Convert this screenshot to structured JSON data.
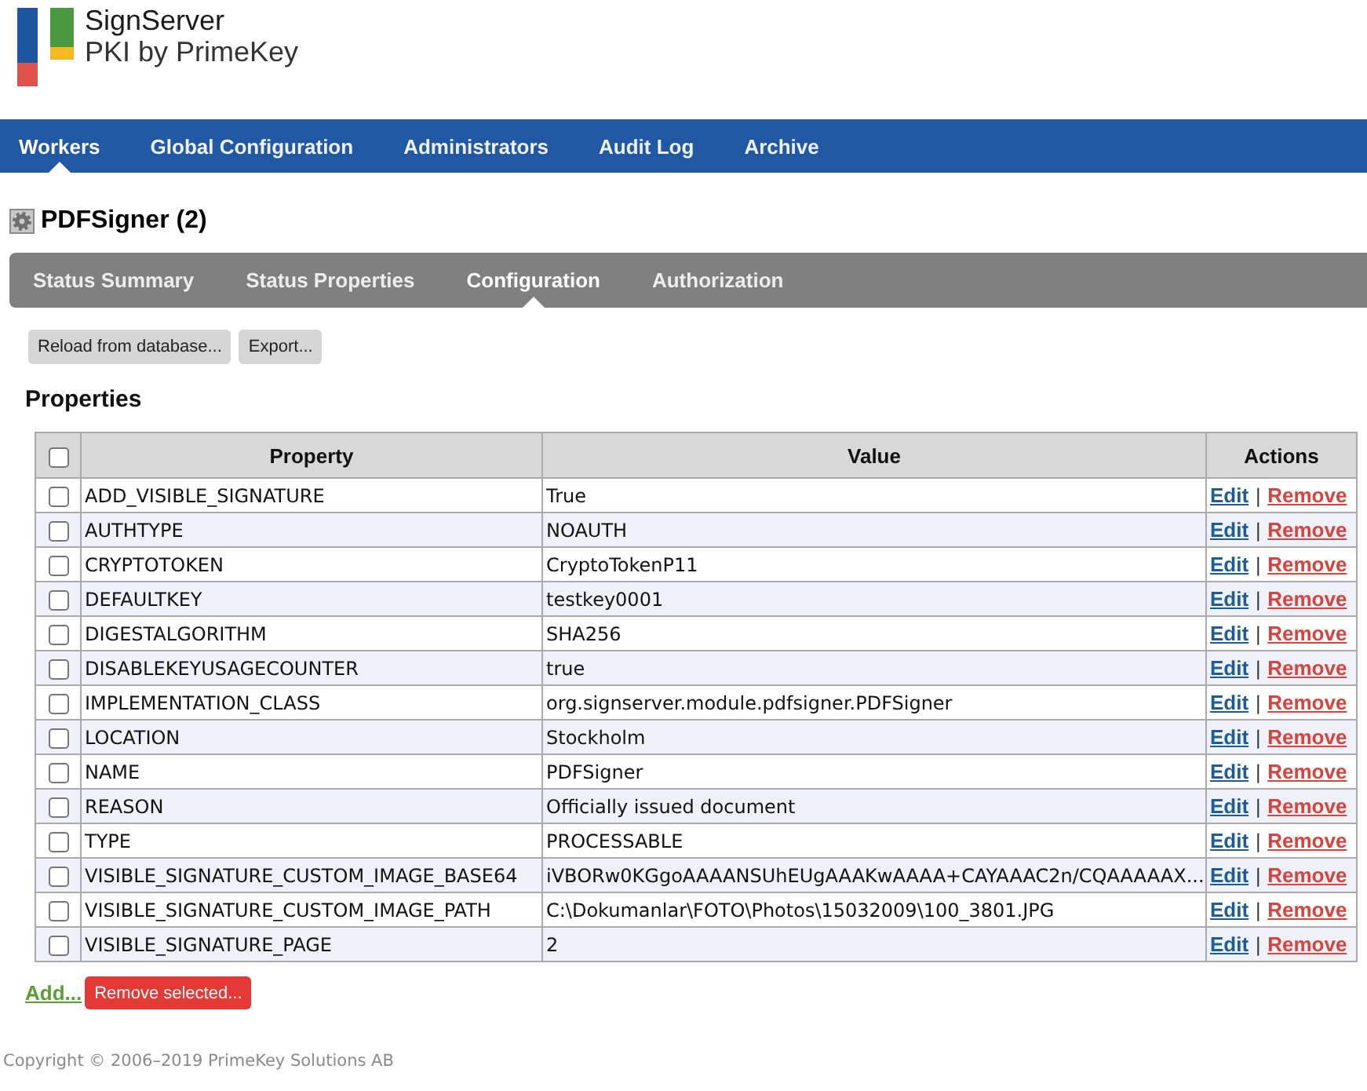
{
  "brand": {
    "name": "SignServer",
    "tagline": "PKI by PrimeKey"
  },
  "nav": [
    {
      "label": "Workers",
      "selected": true
    },
    {
      "label": "Global Configuration",
      "selected": false
    },
    {
      "label": "Administrators",
      "selected": false
    },
    {
      "label": "Audit Log",
      "selected": false
    },
    {
      "label": "Archive",
      "selected": false
    }
  ],
  "page_title": "PDFSigner (2)",
  "tabs": [
    {
      "label": "Status Summary",
      "selected": false
    },
    {
      "label": "Status Properties",
      "selected": false
    },
    {
      "label": "Configuration",
      "selected": true
    },
    {
      "label": "Authorization",
      "selected": false
    }
  ],
  "toolbar_buttons": [
    "Reload from database...",
    "Export..."
  ],
  "section_title": "Properties",
  "table": {
    "select_all": {
      "checked": false
    },
    "columns": [
      "Property",
      "Value",
      "Actions"
    ],
    "rows": [
      {
        "checked": false,
        "property": "ADD_VISIBLE_SIGNATURE",
        "value": "True",
        "actions": [
          {
            "kind": "edit",
            "label": "Edit"
          },
          {
            "kind": "separator",
            "label": "|"
          },
          {
            "kind": "remove",
            "label": "Remove"
          }
        ]
      },
      {
        "checked": false,
        "property": "AUTHTYPE",
        "value": "NOAUTH",
        "actions": [
          {
            "kind": "edit",
            "label": "Edit"
          },
          {
            "kind": "separator",
            "label": "|"
          },
          {
            "kind": "remove",
            "label": "Remove"
          }
        ]
      },
      {
        "checked": false,
        "property": "CRYPTOTOKEN",
        "value": "CryptoTokenP11",
        "actions": [
          {
            "kind": "edit",
            "label": "Edit"
          },
          {
            "kind": "separator",
            "label": "|"
          },
          {
            "kind": "remove",
            "label": "Remove"
          }
        ]
      },
      {
        "checked": false,
        "property": "DEFAULTKEY",
        "value": "testkey0001",
        "actions": [
          {
            "kind": "edit",
            "label": "Edit"
          },
          {
            "kind": "separator",
            "label": "|"
          },
          {
            "kind": "remove",
            "label": "Remove"
          }
        ]
      },
      {
        "checked": false,
        "property": "DIGESTALGORITHM",
        "value": "SHA256",
        "actions": [
          {
            "kind": "edit",
            "label": "Edit"
          },
          {
            "kind": "separator",
            "label": "|"
          },
          {
            "kind": "remove",
            "label": "Remove"
          }
        ]
      },
      {
        "checked": false,
        "property": "DISABLEKEYUSAGECOUNTER",
        "value": "true",
        "actions": [
          {
            "kind": "edit",
            "label": "Edit"
          },
          {
            "kind": "separator",
            "label": "|"
          },
          {
            "kind": "remove",
            "label": "Remove"
          }
        ]
      },
      {
        "checked": false,
        "property": "IMPLEMENTATION_CLASS",
        "value": "org.signserver.module.pdfsigner.PDFSigner",
        "actions": [
          {
            "kind": "edit",
            "label": "Edit"
          },
          {
            "kind": "separator",
            "label": "|"
          },
          {
            "kind": "remove",
            "label": "Remove"
          }
        ]
      },
      {
        "checked": false,
        "property": "LOCATION",
        "value": "Stockholm",
        "actions": [
          {
            "kind": "edit",
            "label": "Edit"
          },
          {
            "kind": "separator",
            "label": "|"
          },
          {
            "kind": "remove",
            "label": "Remove"
          }
        ]
      },
      {
        "checked": false,
        "property": "NAME",
        "value": "PDFSigner",
        "actions": [
          {
            "kind": "edit",
            "label": "Edit"
          },
          {
            "kind": "separator",
            "label": "|"
          },
          {
            "kind": "remove",
            "label": "Remove"
          }
        ]
      },
      {
        "checked": false,
        "property": "REASON",
        "value": "Officially issued document",
        "actions": [
          {
            "kind": "edit",
            "label": "Edit"
          },
          {
            "kind": "separator",
            "label": "|"
          },
          {
            "kind": "remove",
            "label": "Remove"
          }
        ]
      },
      {
        "checked": false,
        "property": "TYPE",
        "value": "PROCESSABLE",
        "actions": [
          {
            "kind": "edit",
            "label": "Edit"
          },
          {
            "kind": "separator",
            "label": "|"
          },
          {
            "kind": "remove",
            "label": "Remove"
          }
        ]
      },
      {
        "checked": false,
        "property": "VISIBLE_SIGNATURE_CUSTOM_IMAGE_BASE64",
        "value": "iVBORw0KGgoAAAANSUhEUgAAAKwAAAA+CAYAAAC2n/CQAAAAAX...",
        "actions": [
          {
            "kind": "edit",
            "label": "Edit"
          },
          {
            "kind": "separator",
            "label": "|"
          },
          {
            "kind": "remove",
            "label": "Remove"
          }
        ]
      },
      {
        "checked": false,
        "property": "VISIBLE_SIGNATURE_CUSTOM_IMAGE_PATH",
        "value": "C:\\Dokumanlar\\FOTO\\Photos\\15032009\\100_3801.JPG",
        "actions": [
          {
            "kind": "edit",
            "label": "Edit"
          },
          {
            "kind": "separator",
            "label": "|"
          },
          {
            "kind": "remove",
            "label": "Remove"
          }
        ]
      },
      {
        "checked": false,
        "property": "VISIBLE_SIGNATURE_PAGE",
        "value": "2",
        "actions": [
          {
            "kind": "edit",
            "label": "Edit"
          },
          {
            "kind": "separator",
            "label": "|"
          },
          {
            "kind": "remove",
            "label": "Remove"
          }
        ]
      }
    ]
  },
  "bottom_actions": {
    "add_link": "Add...",
    "remove_selected_button": "Remove selected..."
  },
  "footer": "Copyright © 2006–2019 PrimeKey Solutions AB"
}
